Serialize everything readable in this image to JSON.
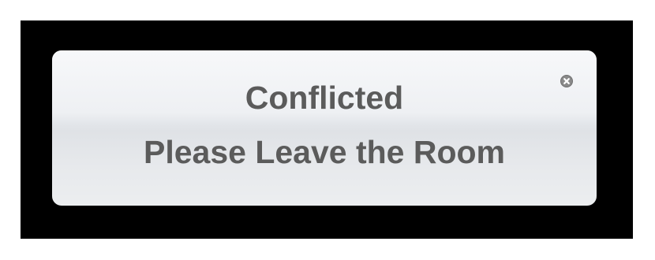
{
  "dialog": {
    "title": "Conflicted",
    "message": "Please Leave the Room",
    "close_icon": "close-icon",
    "text_color": "#5b5b5b"
  }
}
